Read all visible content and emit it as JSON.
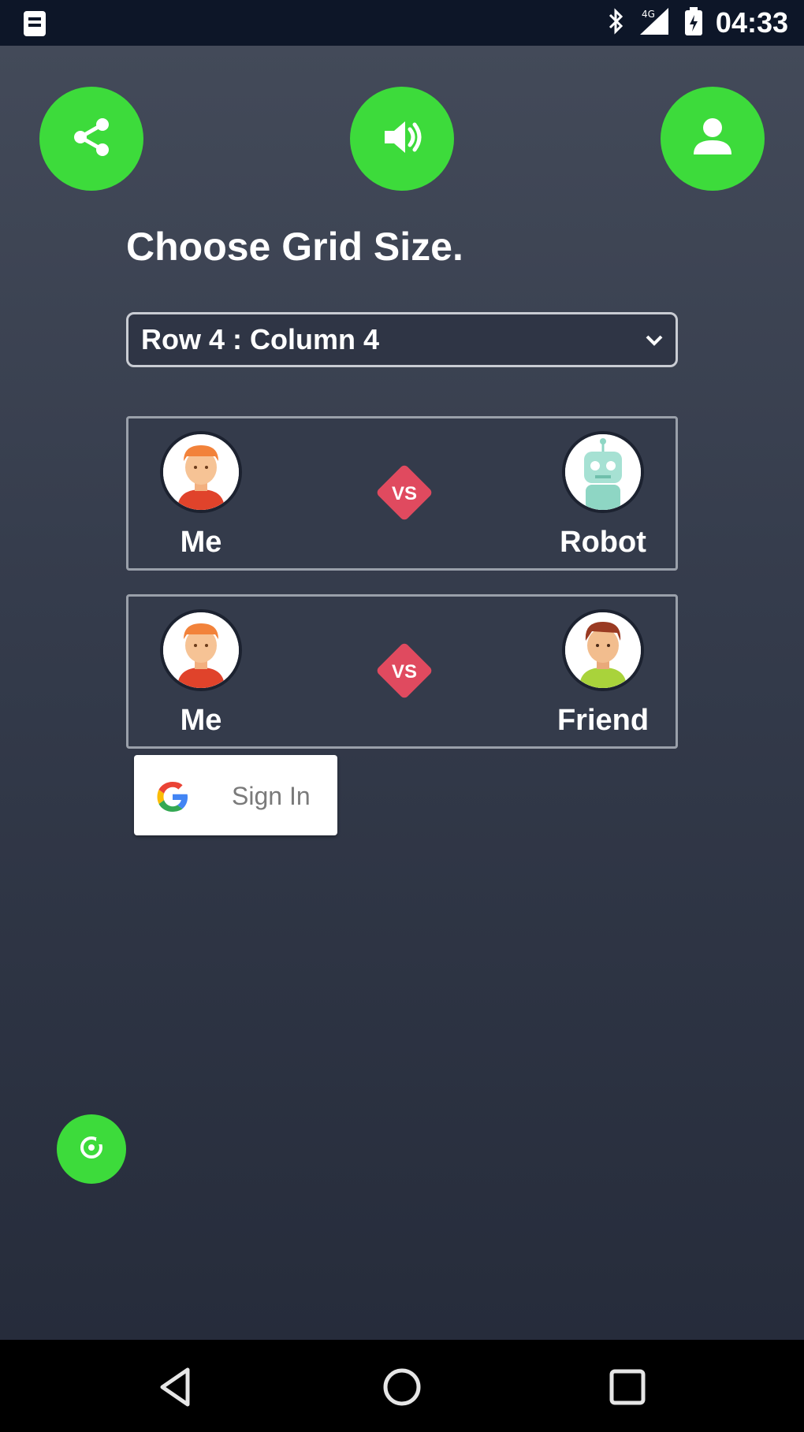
{
  "status_bar": {
    "time": "04:33",
    "network": "4G",
    "icons": [
      "sim-card-icon",
      "bluetooth-icon",
      "signal-icon",
      "battery-icon"
    ]
  },
  "toolbar": {
    "share_icon": "share-icon",
    "sound_icon": "volume-icon",
    "profile_icon": "person-icon",
    "accent_color": "#3ddb3b"
  },
  "main": {
    "title": "Choose Grid Size.",
    "grid_select": {
      "value": "Row 4 : Column 4"
    }
  },
  "matches": [
    {
      "left_player": "Me",
      "right_player": "Robot",
      "badge": "VS"
    },
    {
      "left_player": "Me",
      "right_player": "Friend",
      "badge": "VS"
    }
  ],
  "google_signin": {
    "label": "Sign In"
  },
  "colors": {
    "vs_badge": "#e04a5f",
    "button_green": "#3ddb3b",
    "background_top": "#434a59",
    "background_bottom": "#262c3b"
  }
}
